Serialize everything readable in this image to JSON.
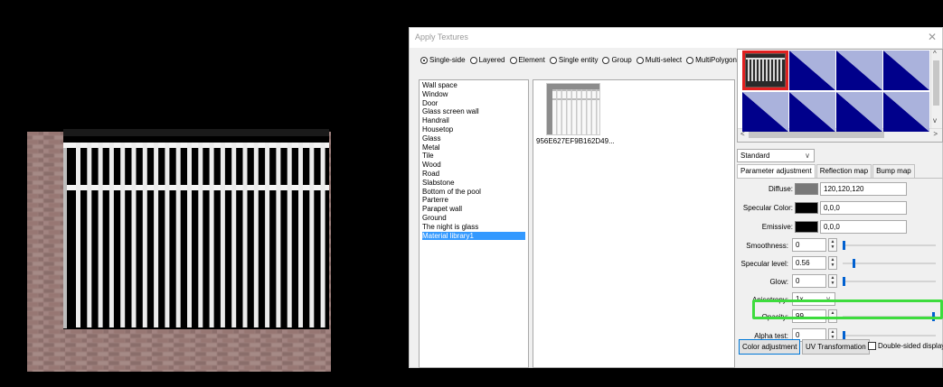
{
  "dialog": {
    "title": "Apply Textures",
    "close_symbol": "✕"
  },
  "modes": [
    {
      "label": "Single-side",
      "selected": true
    },
    {
      "label": "Layered",
      "selected": false
    },
    {
      "label": "Element",
      "selected": false
    },
    {
      "label": "Single entity",
      "selected": false
    },
    {
      "label": "Group",
      "selected": false
    },
    {
      "label": "Multi-select",
      "selected": false
    },
    {
      "label": "MultiPolygon",
      "selected": false
    }
  ],
  "categories": {
    "items": [
      "Wall space",
      "Window",
      "Door",
      "Glass screen wall",
      "Handrail",
      "Housetop",
      "Glass",
      "Metal",
      "Tile",
      "Wood",
      "Road",
      "Slabstone",
      "Bottom of the pool",
      "Parterre",
      "Parapet wall",
      "Ground",
      "The night is glass",
      "Material library1"
    ],
    "selected": "Material library1"
  },
  "thumbnail": {
    "caption": "956E627EF9B162D49..."
  },
  "swatch_colors": {
    "navy": "#00008b",
    "lavender": "#aab2dc",
    "selected_border": "#e02020"
  },
  "render_mode": {
    "value": "Standard"
  },
  "tabs": [
    "Parameter adjustment",
    "Reflection map",
    "Bump map"
  ],
  "params": {
    "diffuse": {
      "label": "Diffuse:",
      "value": "120,120,120",
      "color": "#787878"
    },
    "specular": {
      "label": "Specular Color:",
      "value": "0,0,0",
      "color": "#000000"
    },
    "emissive": {
      "label": "Emissive:",
      "value": "0,0,0",
      "color": "#000000"
    },
    "smoothness": {
      "label": "Smoothness:",
      "value": "0",
      "level": 0
    },
    "specular_level": {
      "label": "Specular level:",
      "value": "0.56",
      "level": 0.11
    },
    "glow": {
      "label": "Glow:",
      "value": "0",
      "level": 0
    },
    "anisotropy": {
      "label": "Anisotropy:",
      "value": "1x"
    },
    "opacity": {
      "label": "Opacity:",
      "value": "99",
      "level": 0.99
    },
    "alpha_test": {
      "label": "Alpha test:",
      "value": "0",
      "level": 0
    }
  },
  "buttons": {
    "color_adjustment": "Color adjustment",
    "uv_transformation": "UV Transformation",
    "double_sided": "Double-sided display"
  },
  "highlight_color": "#3ddc3d",
  "scroll_arrows": {
    "left": "<",
    "right": ">",
    "up": "^",
    "down": "v"
  }
}
